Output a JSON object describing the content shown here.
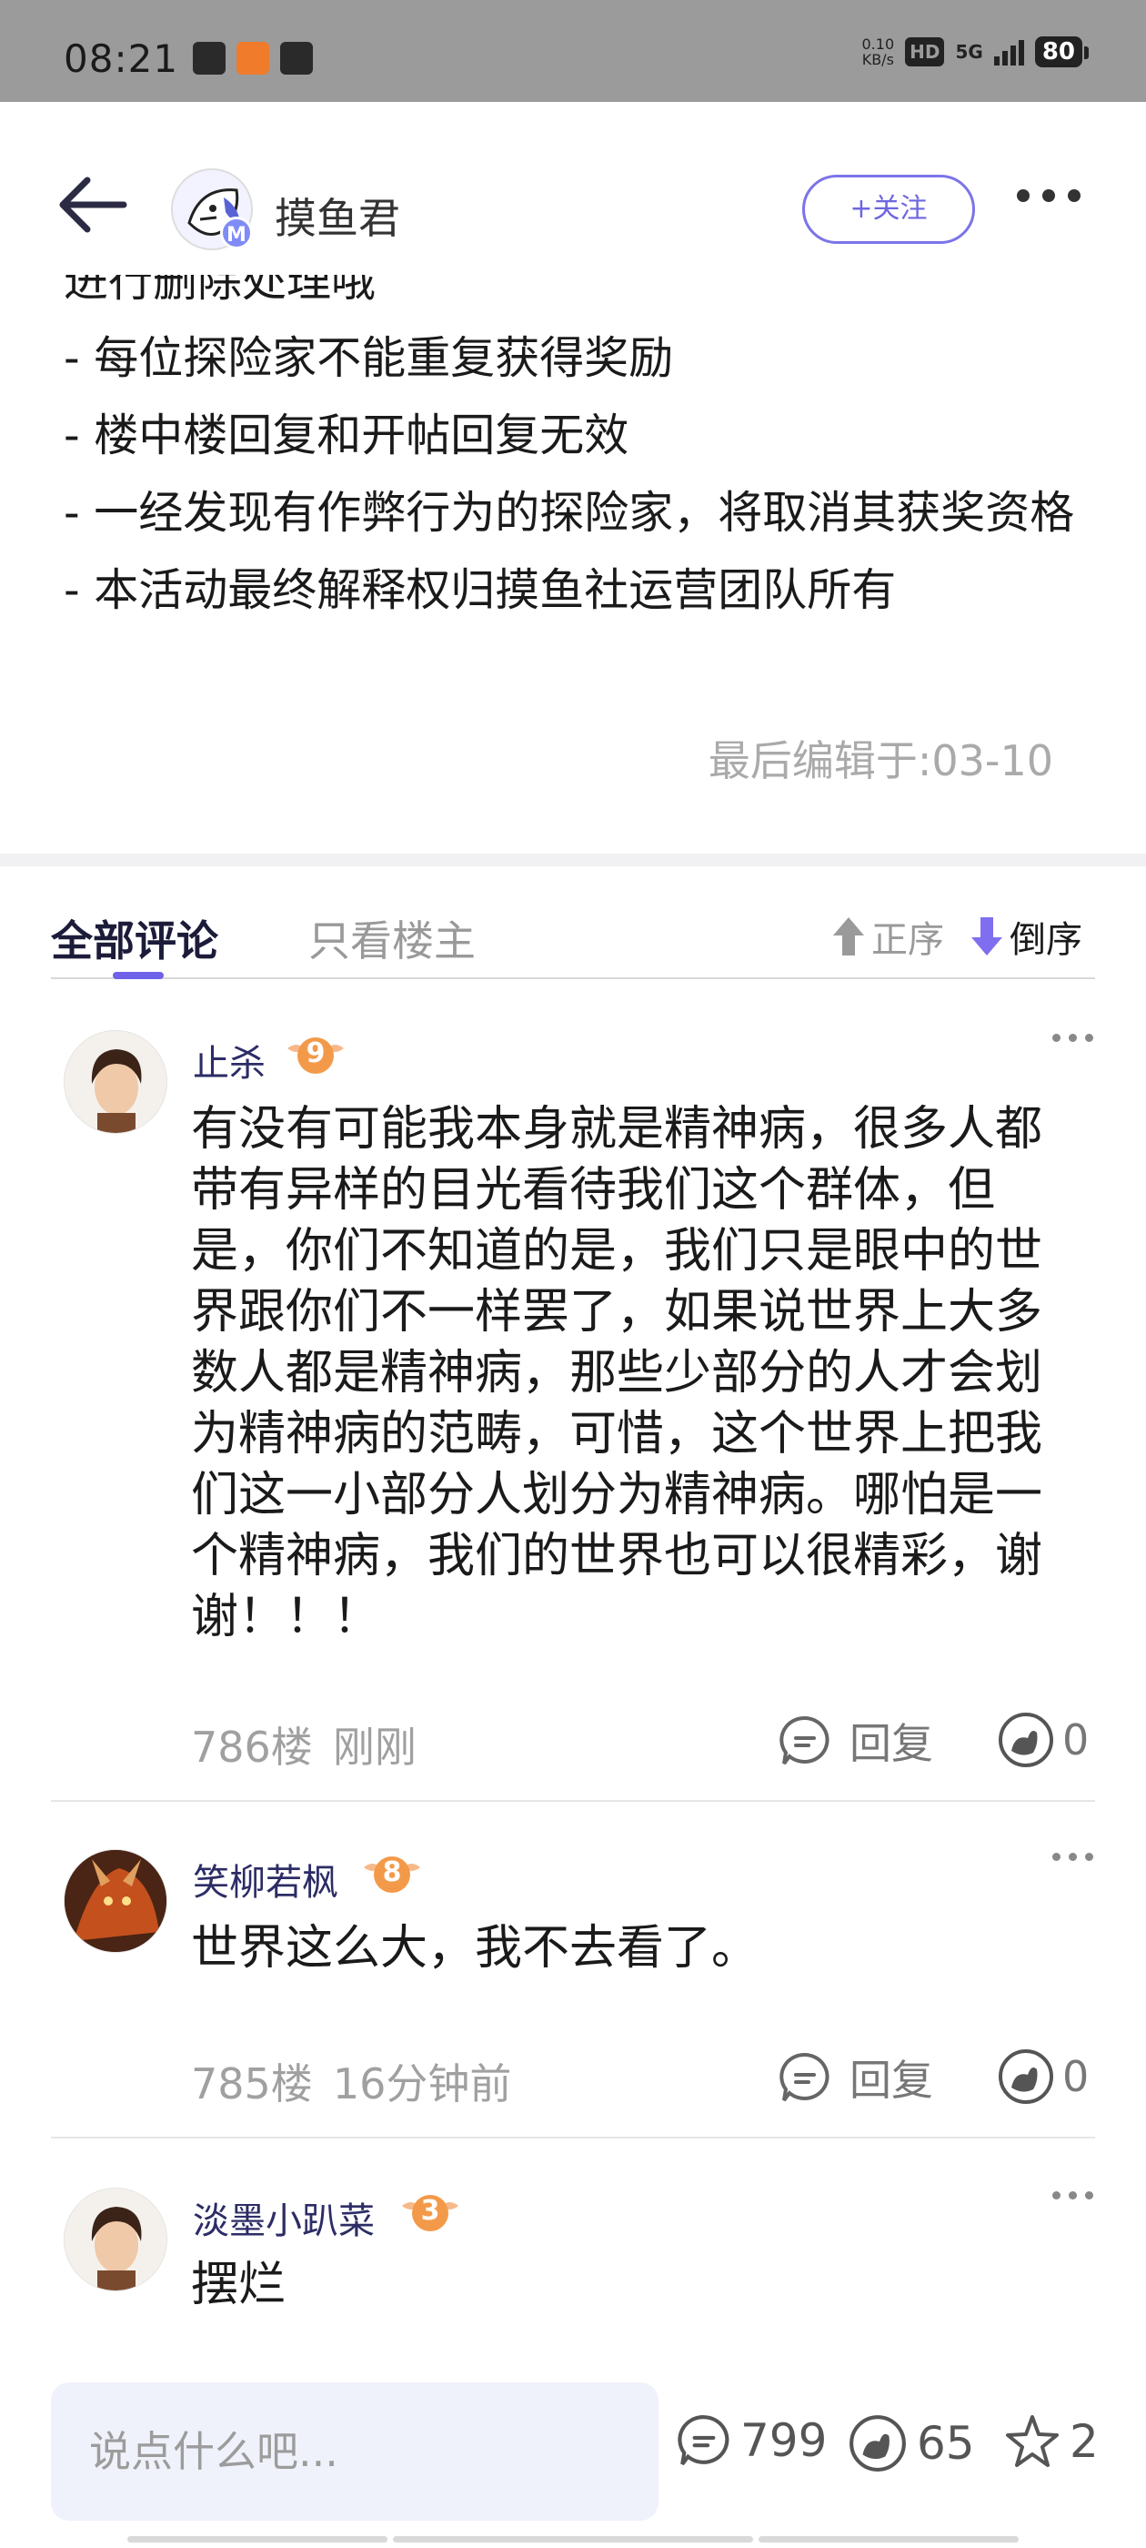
{
  "status_bar": {
    "time": "08:21",
    "net_speed_value": "0.10",
    "net_speed_unit": "KB/s",
    "hd_label": "HD",
    "network_label": "5G",
    "battery": "80"
  },
  "header": {
    "author_name": "摸鱼君",
    "avatar_badge": "M",
    "follow_label": "+关注"
  },
  "post": {
    "partial_line": "进行删除处理哦",
    "lines": [
      "- 每位探险家不能重复获得奖励",
      "- 楼中楼回复和开帖回复无效",
      "- 一经发现有作弊行为的探险家，将取消其获奖资格",
      "- 本活动最终解释权归摸鱼社运营团队所有"
    ],
    "edited": "最后编辑于:03-10"
  },
  "tabs": {
    "all_comments": "全部评论",
    "only_op": "只看楼主",
    "sort_asc": "正序",
    "sort_desc": "倒序"
  },
  "comments": [
    {
      "name": "止杀",
      "level": "9",
      "text": "有没有可能我本身就是精神病，很多人都带有异样的目光看待我们这个群体，但是，你们不知道的是，我们只是眼中的世界跟你们不一样罢了，如果说世界上大多数人都是精神病，那些少部分的人才会划为精神病的范畴，可惜，这个世界上把我们这一小部分人划分为精神病。哪怕是一个精神病，我们的世界也可以很精彩，谢谢！！！",
      "floor": "786楼",
      "time": "刚刚",
      "reply_label": "回复",
      "likes": "0"
    },
    {
      "name": "笑柳若枫",
      "level": "8",
      "text": "世界这么大，我不去看了。",
      "floor": "785楼",
      "time": "16分钟前",
      "reply_label": "回复",
      "likes": "0"
    },
    {
      "name": "淡墨小趴菜",
      "level": "3",
      "text": "摆烂"
    }
  ],
  "bottom_bar": {
    "input_placeholder": "说点什么吧...",
    "comment_count": "799",
    "like_count": "65",
    "fav_count": "2"
  },
  "colors": {
    "accent": "#6f62e8",
    "name_color": "#2c2c66",
    "level_badge": "#f39a4a"
  }
}
